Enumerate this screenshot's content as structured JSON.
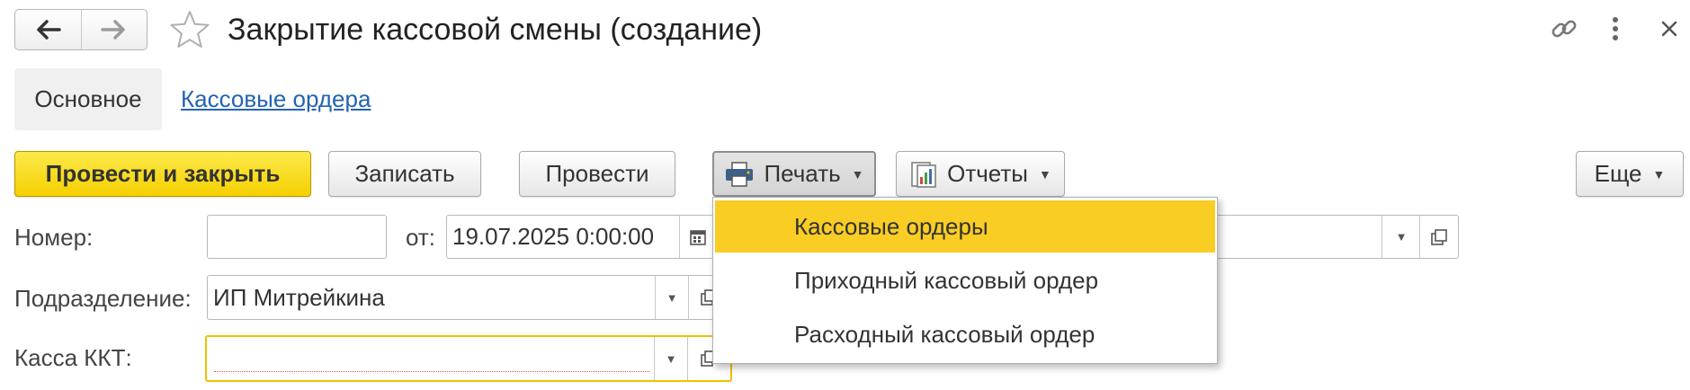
{
  "window": {
    "title": "Закрытие кассовой смены (создание)",
    "icons": {
      "back": "arrow-left-icon",
      "forward": "arrow-right-icon",
      "favorite": "star-icon",
      "link": "link-icon",
      "more": "vertical-dots-icon",
      "close": "close-icon"
    }
  },
  "tabs": [
    {
      "label": "Основное",
      "active": true
    },
    {
      "label": "Кассовые ордера",
      "active": false
    }
  ],
  "toolbar": {
    "post_close": "Провести и закрыть",
    "save": "Записать",
    "post": "Провести",
    "print": "Печать",
    "reports": "Отчеты",
    "more": "Еще",
    "icons": {
      "print": "printer-icon",
      "reports": "reports-icon"
    }
  },
  "form": {
    "number": {
      "label": "Номер:",
      "value": ""
    },
    "date": {
      "label": "от:",
      "value": "19.07.2025  0:00:00"
    },
    "department": {
      "label": "Подразделение:",
      "value": "ИП Митрейкина"
    },
    "register": {
      "label": "Касса ККТ:",
      "value": ""
    }
  },
  "print_menu": {
    "items": [
      "Кассовые ордеры",
      "Приходный кассовый ордер",
      "Расходный кассовый ордер"
    ],
    "highlighted": 0
  },
  "colors": {
    "primary_button": "#f5d000",
    "menu_highlight": "#f9cd24",
    "link": "#2463b0",
    "required_border": "#f0c000"
  }
}
